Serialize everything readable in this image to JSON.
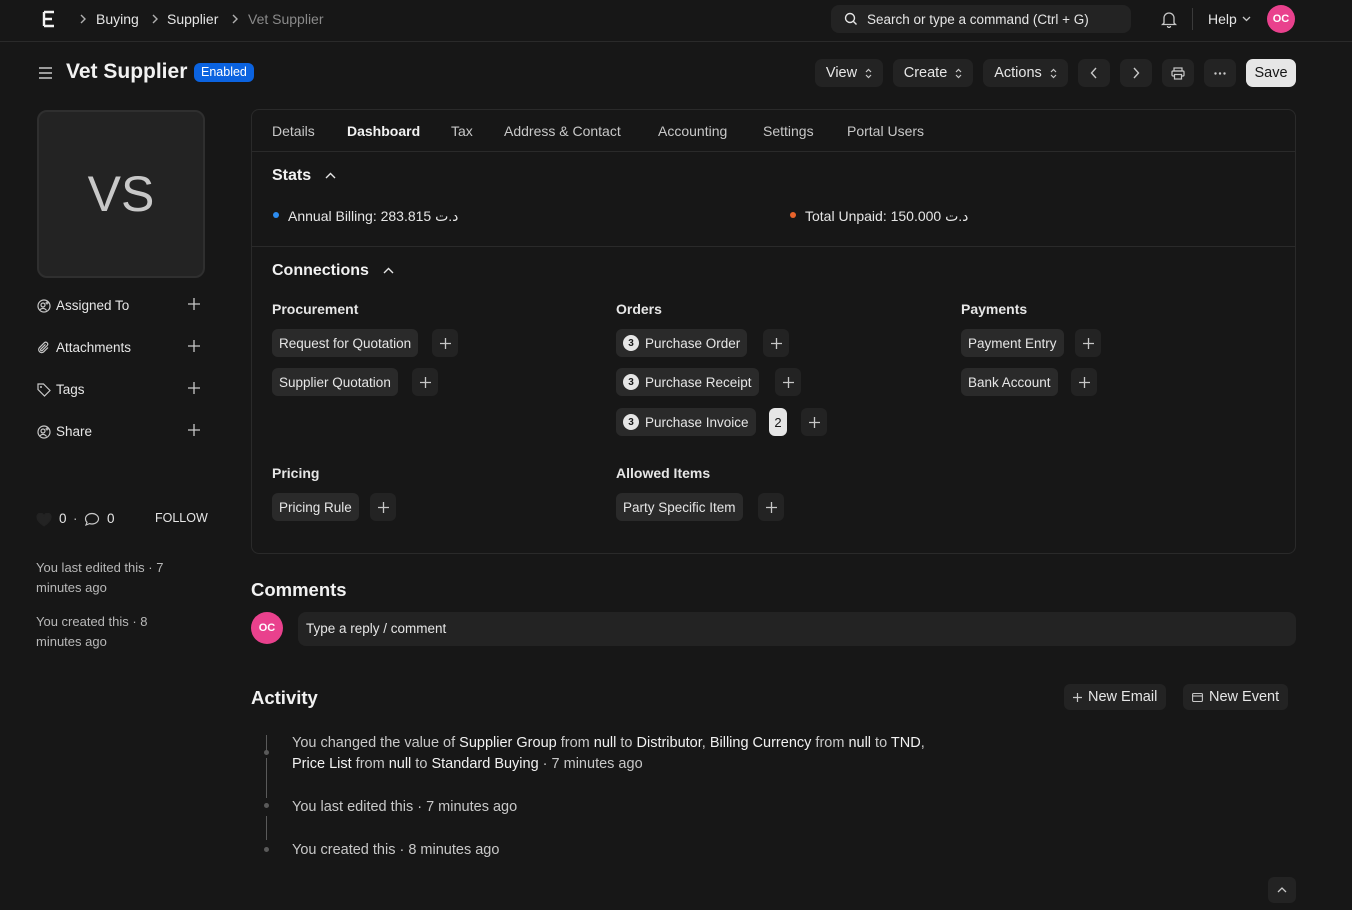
{
  "navbar": {
    "breadcrumbs": [
      "Buying",
      "Supplier",
      "Vet Supplier"
    ],
    "search_placeholder": "Search or type a command (Ctrl + G)",
    "help_label": "Help",
    "avatar_initials": "OC"
  },
  "header": {
    "title": "Vet Supplier",
    "status": "Enabled",
    "view_label": "View",
    "create_label": "Create",
    "actions_label": "Actions",
    "save_label": "Save"
  },
  "sidebar": {
    "image_initials": "VS",
    "items": [
      {
        "label": "Assigned To",
        "icon": "user-plus-icon"
      },
      {
        "label": "Attachments",
        "icon": "paperclip-icon"
      },
      {
        "label": "Tags",
        "icon": "tag-icon"
      },
      {
        "label": "Share",
        "icon": "share-user-icon"
      }
    ],
    "likes": "0",
    "comments_count": "0",
    "follow_label": "FOLLOW",
    "last_edited": "You last edited this · 7 minutes ago",
    "created": "You created this · 8 minutes ago"
  },
  "tabs": [
    "Details",
    "Dashboard",
    "Tax",
    "Address & Contact",
    "Accounting",
    "Settings",
    "Portal Users"
  ],
  "active_tab": "Dashboard",
  "stats": {
    "title": "Stats",
    "annual_billing": "Annual Billing: 283.815 د.ت",
    "total_unpaid": "Total Unpaid: 150.000 د.ت",
    "colors": {
      "billing": "#2d8cf0",
      "unpaid": "#e8632b"
    }
  },
  "connections": {
    "title": "Connections",
    "groups": {
      "procurement": {
        "label": "Procurement",
        "items": [
          "Request for Quotation",
          "Supplier Quotation"
        ]
      },
      "orders": {
        "label": "Orders",
        "items": [
          {
            "label": "Purchase Order",
            "count": "3"
          },
          {
            "label": "Purchase Receipt",
            "count": "3"
          },
          {
            "label": "Purchase Invoice",
            "count": "3",
            "extra": "2"
          }
        ]
      },
      "payments": {
        "label": "Payments",
        "items": [
          "Payment Entry",
          "Bank Account"
        ]
      },
      "pricing": {
        "label": "Pricing",
        "items": [
          "Pricing Rule"
        ]
      },
      "allowed_items": {
        "label": "Allowed Items",
        "items": [
          "Party Specific Item"
        ]
      }
    }
  },
  "comments": {
    "title": "Comments",
    "avatar_initials": "OC",
    "placeholder": "Type a reply / comment"
  },
  "activity": {
    "title": "Activity",
    "new_email_label": "New Email",
    "new_event_label": "New Event",
    "entries": [
      {
        "p1": "You changed the value of ",
        "b1": "Supplier Group",
        "p2": " from ",
        "b2": "null",
        "p3": " to ",
        "b3": "Distributor",
        "p4": ", ",
        "b4": "Billing Currency",
        "p5": " from ",
        "b5": "null",
        "p6": " to ",
        "b6": "TND",
        "p7": ",",
        "b7": "Price List",
        "p8": " from ",
        "b8": "null",
        "p9": " to ",
        "b9": "Standard Buying",
        "time": " · 7 minutes ago"
      },
      {
        "text": "You last edited this · 7 minutes ago"
      },
      {
        "text": "You created this · 8 minutes ago"
      }
    ]
  }
}
